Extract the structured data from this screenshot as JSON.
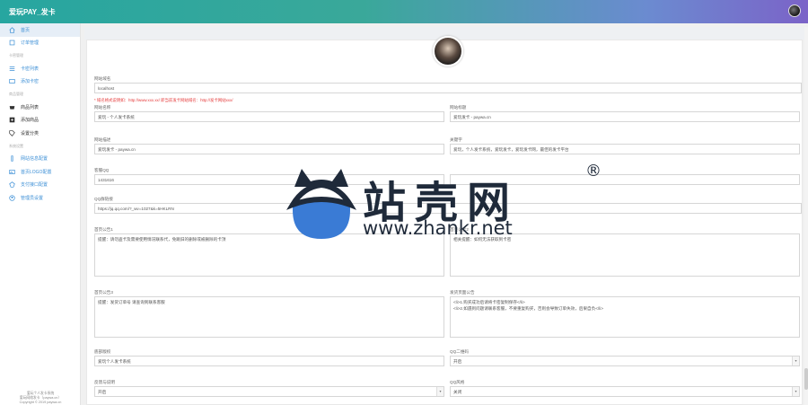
{
  "topbar": {
    "brand": "爱玩PAY_发卡"
  },
  "sidebar": {
    "items": [
      {
        "label": "首页",
        "icon": "home-icon",
        "kind": "item",
        "active": true
      },
      {
        "label": "订单管理",
        "icon": "order-icon",
        "kind": "item"
      },
      {
        "label": "卡密管理",
        "kind": "head"
      },
      {
        "label": "卡密列表",
        "icon": "list-icon",
        "kind": "item"
      },
      {
        "label": "添加卡密",
        "icon": "add-icon",
        "kind": "item"
      },
      {
        "label": "商品管理",
        "kind": "head"
      },
      {
        "label": "商品列表",
        "icon": "shop-icon",
        "kind": "dark"
      },
      {
        "label": "添加商品",
        "icon": "plus-icon",
        "kind": "dark"
      },
      {
        "label": "设置分类",
        "icon": "tag-icon",
        "kind": "dark"
      },
      {
        "label": "系统设置",
        "kind": "head"
      },
      {
        "label": "网站信息配置",
        "icon": "settings-icon",
        "kind": "item"
      },
      {
        "label": "首页LOGO配置",
        "icon": "image-icon",
        "kind": "item"
      },
      {
        "label": "支付接口配置",
        "icon": "pay-icon",
        "kind": "item"
      },
      {
        "label": "管理员设置",
        "icon": "user-icon",
        "kind": "item"
      }
    ],
    "footer": [
      "爱玩个人发卡系统",
      "爱玩网络发卡（paywa.cn）",
      "Copyright © 2019 paywa.cn"
    ]
  },
  "form": {
    "site_url_label": "网站域名",
    "site_url_value": "localhost",
    "note": "* 域名格式说明如：http://www.xxx.xx/  即当前发卡网站域名：http://发卡网站xxx/",
    "site_name_label": "网站名称",
    "site_name_value": "爱玩 - 个人发卡系统",
    "site_title_label": "网站标题",
    "site_title_value": "爱玩发卡 - paywa.cn",
    "site_desc_label": "网站描述",
    "site_desc_value": "爱玩发卡 - paywa.cn",
    "keywords_label": "关键字",
    "keywords_value": "爱玩，个人发卡系统，爱玩发卡，爱玩发卡网，最佳的发卡平台",
    "qq_label": "客服QQ",
    "qq_value": "1431616",
    "group_label": "QQ群链接",
    "group_value": "https://jq.qq.com/?_wv=1027&k=5HKLRN",
    "notice1_label": "首页公告1",
    "notice1_value": "提醒：请勿盗卡及需要使用情况联系代，免跳旧的删除或被删除的卡顶",
    "notice1b_label": "首页公告2",
    "notice1b_value": "相关提醒：如何无法获取到卡密",
    "notice2_label": "首页公告3",
    "notice2_value": "提醒：发货订单号 请查询到联系客服",
    "footer_notice_label": "发货页面公告",
    "footer_notice_value": "<li>1.购买成功后请将卡密复制保存</li>\n<li>2.如遇到问题请联系客服，不要重复购买，否则会导致订单失效，后果自负</li>",
    "footer_label": "底部版权",
    "footer_value": "爱玩个人发卡系统",
    "qq_switch_label": "QQ二维码",
    "qq_switch_value": "开启",
    "copy_label": "反馈与说明",
    "copy_value": "开启",
    "qq_style_label": "QQ风格",
    "qq_style_value": "关闭"
  },
  "watermark": {
    "cn": "站壳网",
    "reg": "®",
    "url": "www.zhankr.net"
  },
  "colors": {
    "accent": "#3c8fd6",
    "topbar_start": "#27a6a0",
    "topbar_end": "#7b63c8",
    "note": "#e53b3b"
  }
}
